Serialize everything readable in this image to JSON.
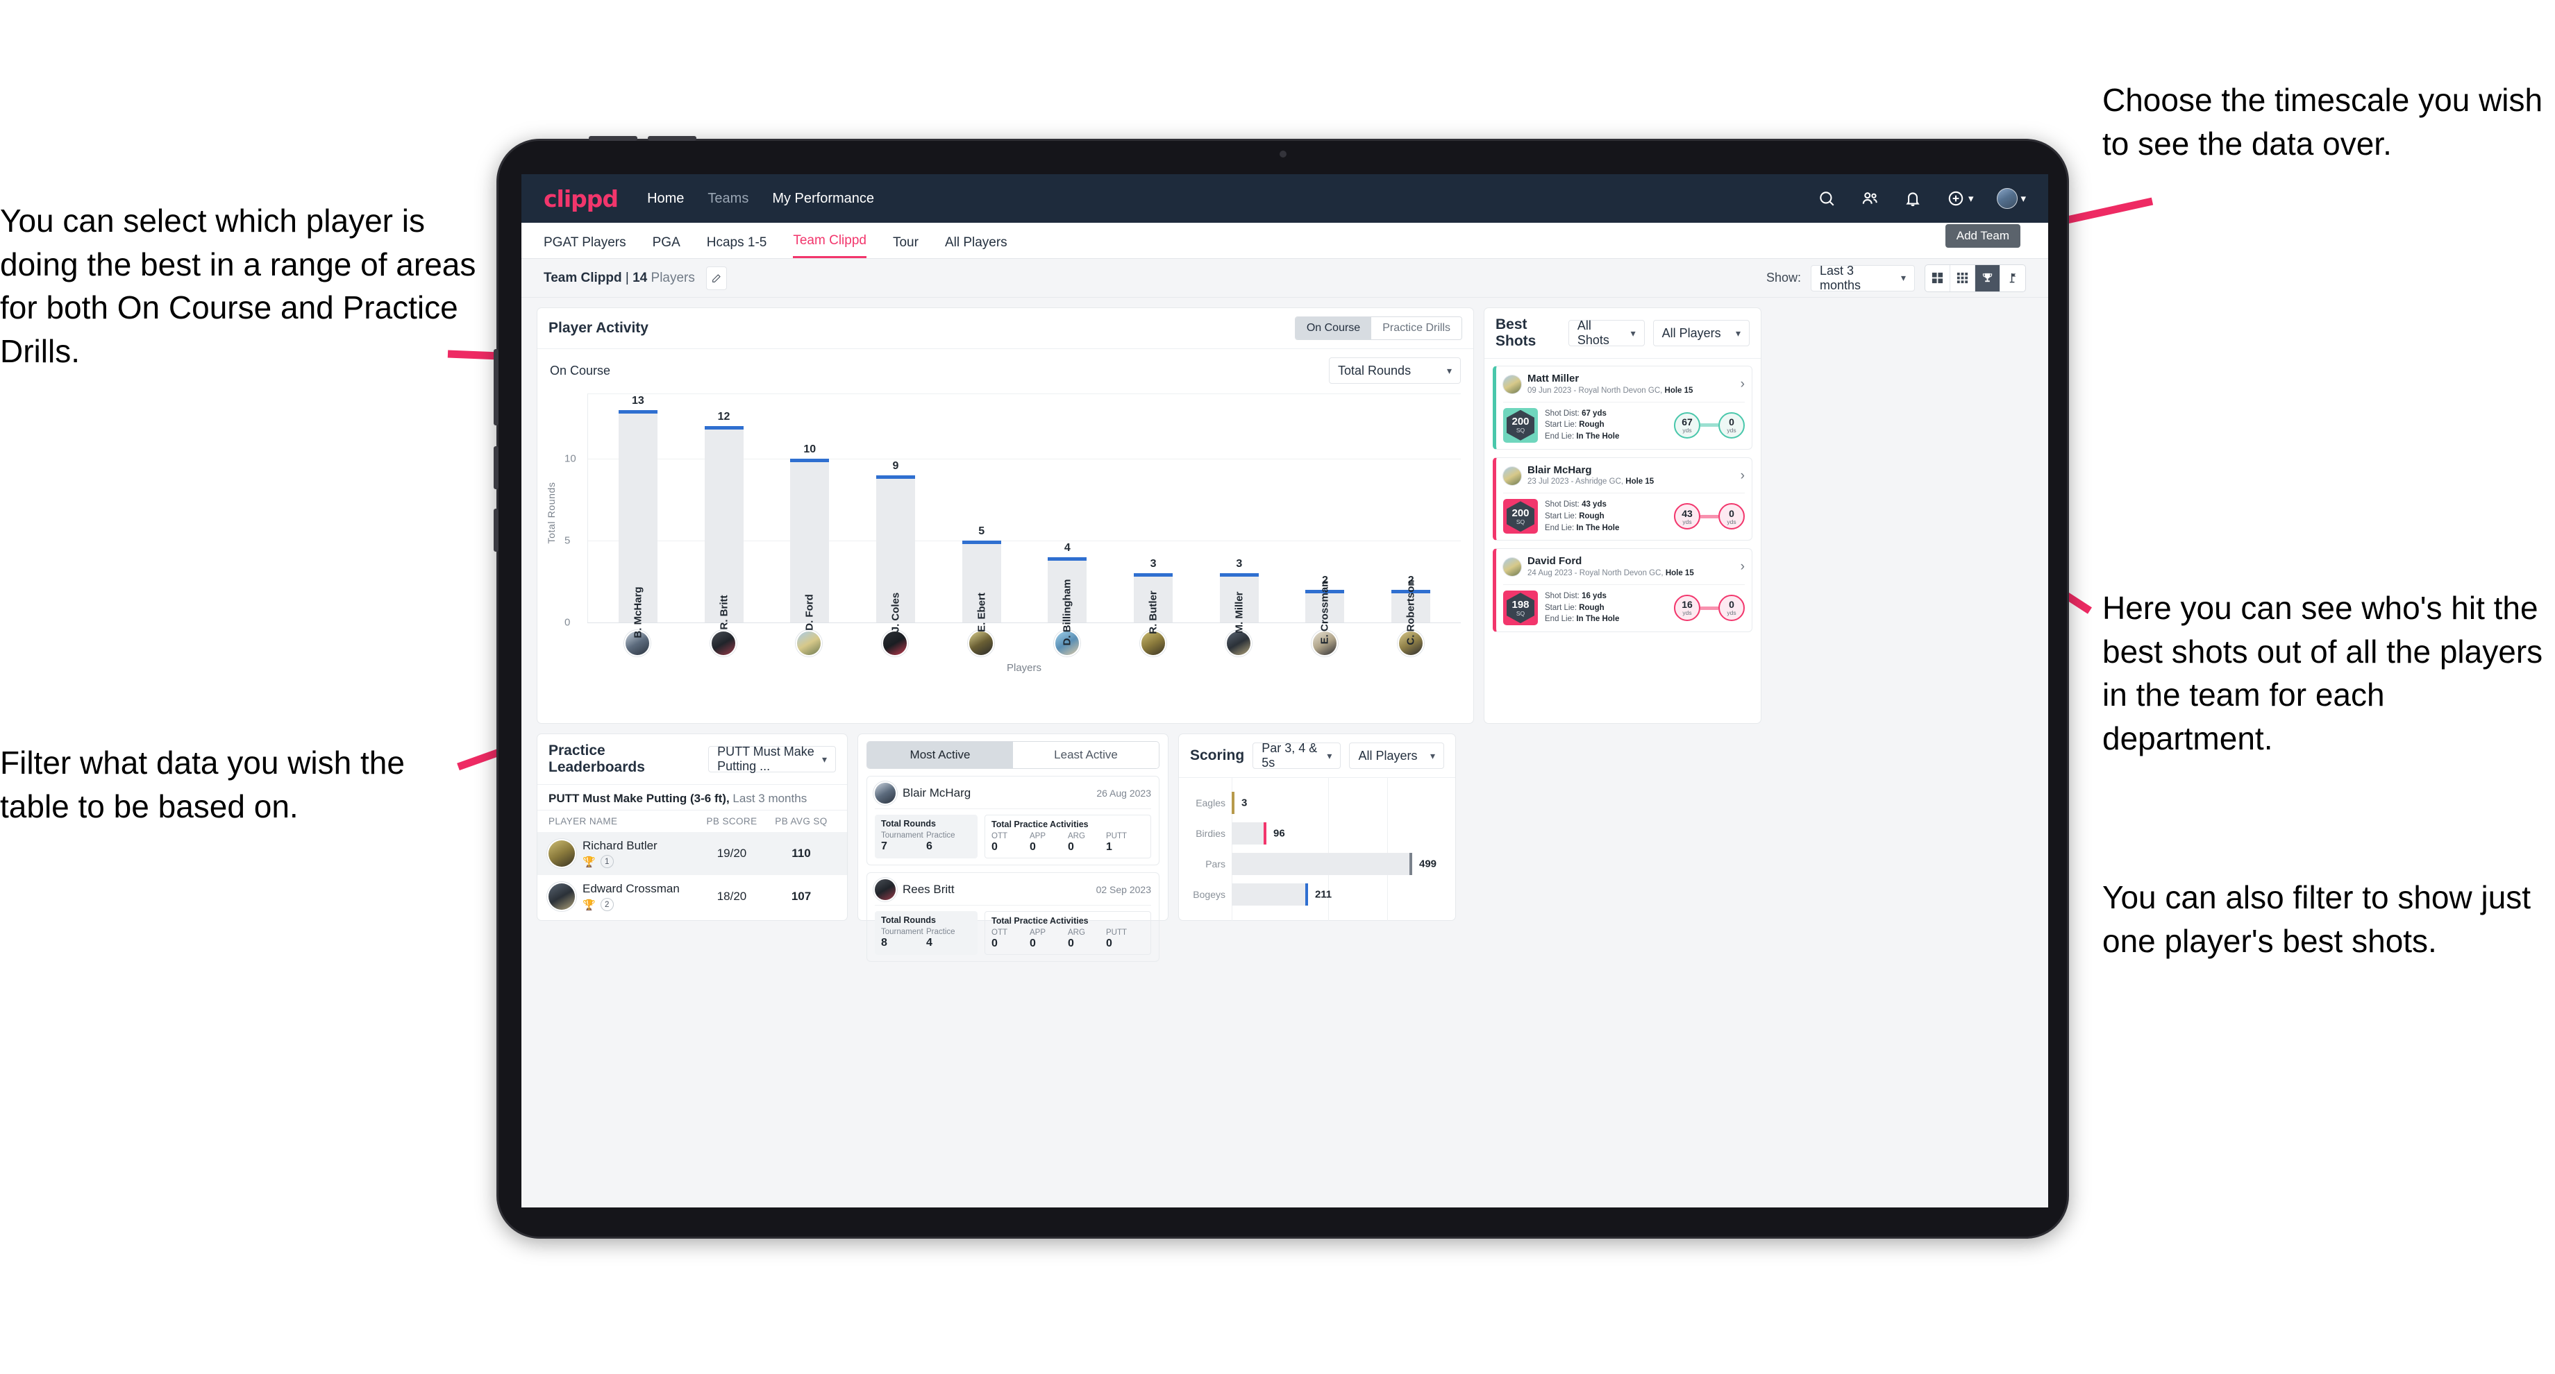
{
  "annotations": {
    "left_top": "You can select which player is doing the best in a range of areas for both On Course and Practice Drills.",
    "left_bottom": "Filter what data you wish the table to be based on.",
    "right_top": "Choose the timescale you wish to see the data over.",
    "right_middle": "Here you can see who's hit the best shots out of all the players in the team for each department.",
    "right_bottom": "You can also filter to show just one player's best shots."
  },
  "topnav": {
    "logo": "clippd",
    "links": [
      {
        "label": "Home",
        "active": true
      },
      {
        "label": "Teams",
        "active": false
      },
      {
        "label": "My Performance",
        "active": true
      }
    ],
    "icons": [
      "search-icon",
      "people-icon",
      "bell-icon",
      "plus-circle-icon",
      "avatar"
    ]
  },
  "subnav": {
    "tabs": [
      {
        "label": "PGAT Players",
        "state": "normal"
      },
      {
        "label": "PGA",
        "state": "normal"
      },
      {
        "label": "Hcaps 1-5",
        "state": "normal"
      },
      {
        "label": "Team Clippd",
        "state": "active"
      },
      {
        "label": "Tour",
        "state": "normal"
      },
      {
        "label": "All Players",
        "state": "normal"
      }
    ],
    "add_team_tooltip": "Add Team"
  },
  "toolbar": {
    "team_name": "Team Clippd",
    "separator": "|",
    "player_count": "14",
    "players_word": "Players",
    "edit_icon": "pencil-icon",
    "show_label": "Show:",
    "timescale_value": "Last 3 months",
    "view_buttons": [
      "grid-large-icon",
      "grid-small-icon",
      "trophy-icon",
      "flag-icon"
    ],
    "active_view": "trophy-icon"
  },
  "player_activity": {
    "title": "Player Activity",
    "segment": {
      "options": [
        "On Course",
        "Practice Drills"
      ],
      "selected": "On Course"
    },
    "sub_label": "On Course",
    "metric_select": "Total Rounds"
  },
  "chart_data": [
    {
      "type": "bar",
      "title": "Player Activity",
      "xlabel": "Players",
      "ylabel": "Total Rounds",
      "categories": [
        "B. McHarg",
        "R. Britt",
        "D. Ford",
        "J. Coles",
        "E. Ebert",
        "D. Billingham",
        "R. Butler",
        "M. Miller",
        "E. Crossman",
        "C. Robertson"
      ],
      "values": [
        13,
        12,
        10,
        9,
        5,
        4,
        3,
        3,
        2,
        2
      ],
      "ylim": [
        0,
        14
      ],
      "yticks": [
        0,
        5,
        10
      ],
      "grid": true,
      "legend": "none"
    },
    {
      "type": "bar",
      "orientation": "horizontal",
      "title": "Scoring",
      "categories": [
        "Eagles",
        "Birdies",
        "Pars",
        "Bogeys"
      ],
      "values": [
        3,
        96,
        499,
        211
      ],
      "colors": [
        "#b79a4b",
        "#f2366c",
        "#7a828c",
        "#2f6fd0"
      ],
      "grid": true,
      "legend": "none"
    }
  ],
  "best_shots": {
    "title": "Best Shots",
    "shot_filter": "All Shots",
    "player_filter": "All Players",
    "items": [
      {
        "name": "Matt Miller",
        "meta_date": "09 Jun 2023 - Royal North Devon GC,",
        "meta_hole": "Hole 15",
        "sq": "200",
        "sq_unit": "SQ",
        "shot_dist_label": "Shot Dist:",
        "shot_dist": "67 yds",
        "start_lie_label": "Start Lie:",
        "start_lie": "Rough",
        "end_lie_label": "End Lie:",
        "end_lie": "In The Hole",
        "from_value": "67",
        "from_unit": "yds",
        "to_value": "0",
        "to_unit": "yds",
        "accent": "teal"
      },
      {
        "name": "Blair McHarg",
        "meta_date": "23 Jul 2023 - Ashridge GC,",
        "meta_hole": "Hole 15",
        "sq": "200",
        "sq_unit": "SQ",
        "shot_dist_label": "Shot Dist:",
        "shot_dist": "43 yds",
        "start_lie_label": "Start Lie:",
        "start_lie": "Rough",
        "end_lie_label": "End Lie:",
        "end_lie": "In The Hole",
        "from_value": "43",
        "from_unit": "yds",
        "to_value": "0",
        "to_unit": "yds",
        "accent": "pink"
      },
      {
        "name": "David Ford",
        "meta_date": "24 Aug 2023 - Royal North Devon GC,",
        "meta_hole": "Hole 15",
        "sq": "198",
        "sq_unit": "SQ",
        "shot_dist_label": "Shot Dist:",
        "shot_dist": "16 yds",
        "start_lie_label": "Start Lie:",
        "start_lie": "Rough",
        "end_lie_label": "End Lie:",
        "end_lie": "In The Hole",
        "from_value": "16",
        "from_unit": "yds",
        "to_value": "0",
        "to_unit": "yds",
        "accent": "pink"
      }
    ]
  },
  "practice_leaderboards": {
    "title": "Practice Leaderboards",
    "drill_select": "PUTT Must Make Putting ...",
    "subtitle_bold": "PUTT Must Make Putting (3-6 ft),",
    "subtitle_light": "Last 3 months",
    "columns": [
      "PLAYER NAME",
      "PB SCORE",
      "PB AVG SQ"
    ],
    "rows": [
      {
        "name": "Richard Butler",
        "pb_score": "19/20",
        "pb_avg_sq": "110",
        "rank": "1",
        "trophy": "gold"
      },
      {
        "name": "Edward Crossman",
        "pb_score": "18/20",
        "pb_avg_sq": "107",
        "rank": "2",
        "trophy": "silver"
      }
    ]
  },
  "activity_panel": {
    "tabs": [
      {
        "label": "Most Active",
        "active": true
      },
      {
        "label": "Least Active",
        "active": false
      }
    ],
    "cards": [
      {
        "name": "Blair McHarg",
        "date": "26 Aug 2023",
        "rounds_title": "Total Rounds",
        "rounds": [
          {
            "key": "Tournament",
            "value": "7"
          },
          {
            "key": "Practice",
            "value": "6"
          }
        ],
        "practice_title": "Total Practice Activities",
        "practice": [
          {
            "key": "OTT",
            "value": "0"
          },
          {
            "key": "APP",
            "value": "0"
          },
          {
            "key": "ARG",
            "value": "0"
          },
          {
            "key": "PUTT",
            "value": "1"
          }
        ]
      },
      {
        "name": "Rees Britt",
        "date": "02 Sep 2023",
        "rounds_title": "Total Rounds",
        "rounds": [
          {
            "key": "Tournament",
            "value": "8"
          },
          {
            "key": "Practice",
            "value": "4"
          }
        ],
        "practice_title": "Total Practice Activities",
        "practice": [
          {
            "key": "OTT",
            "value": "0"
          },
          {
            "key": "APP",
            "value": "0"
          },
          {
            "key": "ARG",
            "value": "0"
          },
          {
            "key": "PUTT",
            "value": "0"
          }
        ]
      }
    ]
  },
  "scoring": {
    "title": "Scoring",
    "par_select": "Par 3, 4 & 5s",
    "player_select": "All Players",
    "rows": [
      {
        "label": "Eagles",
        "value": "3"
      },
      {
        "label": "Birdies",
        "value": "96"
      },
      {
        "label": "Pars",
        "value": "499"
      },
      {
        "label": "Bogeys",
        "value": "211"
      }
    ]
  },
  "colors": {
    "brand_pink": "#f2366c",
    "nav_dark": "#1e2b3c",
    "bar_blue": "#2f6fd0",
    "teal": "#49c7ab",
    "gold": "#b79a4b"
  }
}
